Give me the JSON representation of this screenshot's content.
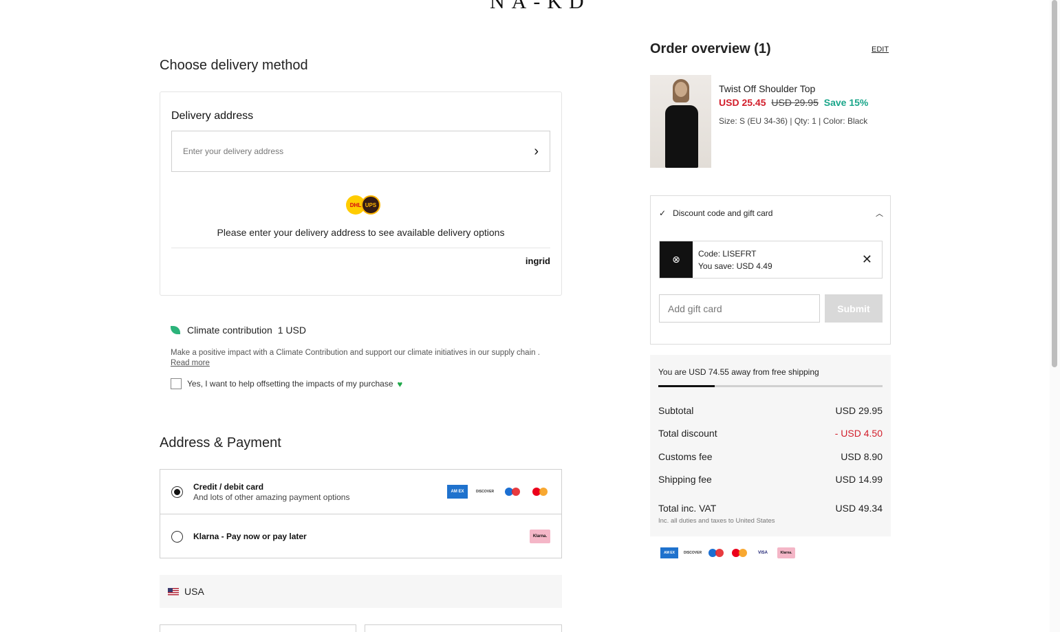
{
  "brand": {
    "logo": "NA-KD"
  },
  "delivery": {
    "heading": "Choose delivery method",
    "card_title": "Delivery address",
    "address_placeholder": "Enter your delivery address",
    "carriers": [
      "DHL",
      "UPS"
    ],
    "message": "Please enter your delivery address to see available delivery options",
    "provider": "ingrid"
  },
  "climate": {
    "title": "Climate contribution",
    "price": "1 USD",
    "description": "Make a positive impact with a Climate Contribution and support our climate initiatives in our supply chain . ",
    "read_more": "Read more",
    "checkbox_label": "Yes, I want to help offsetting the impacts of my purchase",
    "checked": false
  },
  "payment": {
    "heading": "Address & Payment",
    "options": [
      {
        "title": "Credit / debit card",
        "subtitle": "And lots of other amazing payment options",
        "selected": true
      },
      {
        "title": "Klarna - Pay now or pay later",
        "subtitle": "",
        "selected": false
      }
    ],
    "card_icons": [
      "amex-icon",
      "discover-icon",
      "maestro-icon",
      "mastercard-icon"
    ],
    "klarna_icon_text": "Klarna.",
    "country": "USA"
  },
  "order": {
    "title": "Order overview (1)",
    "edit_label": "EDIT",
    "product": {
      "name": "Twist Off Shoulder Top",
      "price_now": "USD 25.45",
      "price_old": "USD 29.95",
      "save": "Save 15%",
      "meta": "Size: S (EU 34-36) | Qty: 1 | Color: Black"
    },
    "discount": {
      "header": "Discount code and gift card",
      "code_line": "Code: LISEFRT",
      "save_line": "You save: USD 4.49",
      "gift_placeholder": "Add gift card",
      "submit_label": "Submit"
    },
    "shipping_message": "You are USD 74.55 away from free shipping",
    "shipping_progress": 0.25,
    "rows": [
      {
        "label": "Subtotal",
        "value": "USD 29.95"
      },
      {
        "label": "Total discount",
        "value": "- USD 4.50"
      },
      {
        "label": "Customs fee",
        "value": "USD 8.90"
      },
      {
        "label": "Shipping fee",
        "value": "USD 14.99"
      }
    ],
    "total_label": "Total inc. VAT",
    "total_value": "USD 49.34",
    "total_note": "Inc. all duties and taxes to United States",
    "footer_icons": [
      "amex-icon",
      "discover-icon",
      "maestro-icon",
      "mastercard-icon",
      "visa-icon",
      "klarna-icon"
    ]
  },
  "colors": {
    "sale": "#d21e2b",
    "save": "#1aa68a",
    "panel": "#f6f6f6"
  }
}
